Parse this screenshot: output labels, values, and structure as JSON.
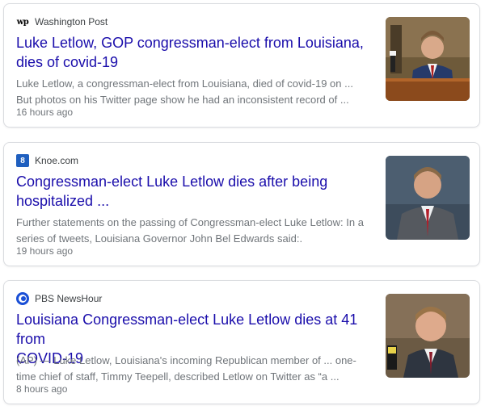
{
  "articles": [
    {
      "source": "Washington Post",
      "favicon": "wp-logo-icon",
      "title": "Luke Letlow, GOP congressman-elect from Louisiana, dies of covid-19",
      "snippet_line1": "Luke Letlow, a congressman-elect from Louisiana, died of covid-19 on ...",
      "snippet_line2": "But photos on his Twitter page show he had an inconsistent record of ...",
      "time": "16 hours ago",
      "thumb_label": "man at podium photo"
    },
    {
      "source": "Knoe.com",
      "favicon": "knoe-logo-icon",
      "title_line1": "Congressman-elect Luke Letlow dies after being",
      "title_line2": "hospitalized ...",
      "snippet_line1": "Further statements on the passing of Congressman-elect Luke Letlow: In a",
      "snippet_line2": "series of tweets, Louisiana Governor John Bel Edwards said:.",
      "time": "19 hours ago",
      "thumb_label": "man in suit portrait"
    },
    {
      "source": "PBS NewsHour",
      "favicon": "pbs-logo-icon",
      "title_line1": "Louisiana Congressman-elect Luke Letlow dies at 41 from",
      "title_line2": "COVID-19",
      "snippet_line1": "(AP) — Luke Letlow, Louisiana's incoming Republican member of ... one-",
      "snippet_line2": "time chief of staff, Timmy Teepell, described Letlow on Twitter as “a ...",
      "time": "8 hours ago",
      "thumb_label": "man speaking photo"
    }
  ],
  "colors": {
    "title": "#1a0dab",
    "meta": "#70757a",
    "border": "#dadce0"
  }
}
